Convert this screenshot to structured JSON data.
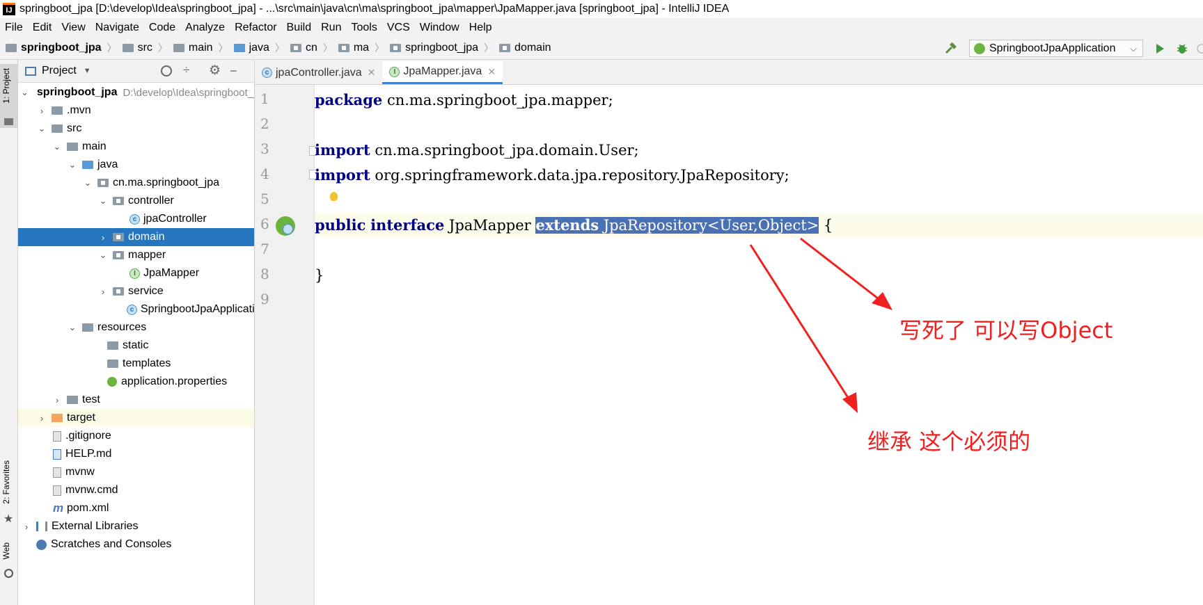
{
  "window": {
    "title": "springboot_jpa [D:\\develop\\Idea\\springboot_jpa] - ...\\src\\main\\java\\cn\\ma\\springboot_jpa\\mapper\\JpaMapper.java [springboot_jpa] - IntelliJ IDEA",
    "app_icon": "IJ"
  },
  "menu": [
    "File",
    "Edit",
    "View",
    "Navigate",
    "Code",
    "Analyze",
    "Refactor",
    "Build",
    "Run",
    "Tools",
    "VCS",
    "Window",
    "Help"
  ],
  "breadcrumbs": [
    "springboot_jpa",
    "src",
    "main",
    "java",
    "cn",
    "ma",
    "springboot_jpa",
    "domain"
  ],
  "run_config": {
    "label": "SpringbootJpaApplication"
  },
  "side_tabs": {
    "project": "1: Project",
    "favorites": "2: Favorites",
    "web": "Web"
  },
  "project_panel": {
    "title": "Project",
    "tree": [
      {
        "label": "springboot_jpa",
        "note": "D:\\develop\\Idea\\springboot_jpa",
        "bold": true
      },
      {
        "label": ".mvn"
      },
      {
        "label": "src"
      },
      {
        "label": "main"
      },
      {
        "label": "java"
      },
      {
        "label": "cn.ma.springboot_jpa"
      },
      {
        "label": "controller"
      },
      {
        "label": "jpaController"
      },
      {
        "label": "domain"
      },
      {
        "label": "mapper"
      },
      {
        "label": "JpaMapper"
      },
      {
        "label": "service"
      },
      {
        "label": "SpringbootJpaApplication"
      },
      {
        "label": "resources"
      },
      {
        "label": "static"
      },
      {
        "label": "templates"
      },
      {
        "label": "application.properties"
      },
      {
        "label": "test"
      },
      {
        "label": "target"
      },
      {
        "label": ".gitignore"
      },
      {
        "label": "HELP.md"
      },
      {
        "label": "mvnw"
      },
      {
        "label": "mvnw.cmd"
      },
      {
        "label": "pom.xml"
      },
      {
        "label": "External Libraries"
      },
      {
        "label": "Scratches and Consoles"
      }
    ]
  },
  "editor_tabs": [
    {
      "label": "jpaController.java",
      "icon": "class-icon"
    },
    {
      "label": "JpaMapper.java",
      "icon": "interface-icon"
    }
  ],
  "line_numbers": [
    "1",
    "2",
    "3",
    "4",
    "5",
    "6",
    "7",
    "8",
    "9"
  ],
  "code": {
    "l1_kw": "package",
    "l1_rest": " cn.ma.springboot_jpa.mapper;",
    "l3_kw": "import",
    "l3_rest": " cn.ma.springboot_jpa.domain.User;",
    "l4_kw": "import",
    "l4_rest": " org.springframework.data.jpa.repository.JpaRepository;",
    "l6_kw1": "public",
    "l6_kw2": "interface",
    "l6_name": " JpaMapper ",
    "l6_sel_kw": "extends",
    "l6_sel_rest": " JpaRepository<User,Object>",
    "l6_tail": " {",
    "l8": "}"
  },
  "annotations": {
    "object_note": "写死了 可以写Object",
    "extends_note": "继承 这个必须的",
    "color": "#f02020"
  }
}
